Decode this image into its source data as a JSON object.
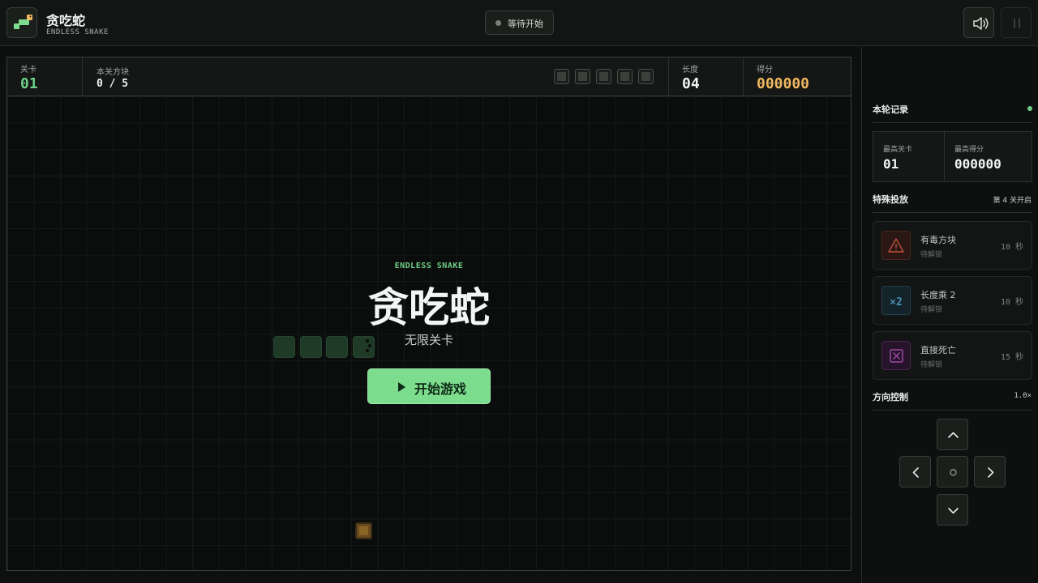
{
  "header": {
    "title": "贪吃蛇",
    "subtitle": "ENDLESS SNAKE",
    "status": "等待开始"
  },
  "stats": {
    "level_label": "关卡",
    "level_value": "01",
    "blocks_label": "本关方块",
    "blocks_value": "0 / 5",
    "length_label": "长度",
    "length_value": "04",
    "score_label": "得分",
    "score_value": "000000"
  },
  "overlay": {
    "kicker": "ENDLESS SNAKE",
    "title": "贪吃蛇",
    "subtitle": "无限关卡",
    "start_label": "开始游戏"
  },
  "records": {
    "section_title": "本轮记录",
    "best_level_label": "最高关卡",
    "best_level_value": "01",
    "best_score_label": "最高得分",
    "best_score_value": "000000"
  },
  "specials": {
    "section_title": "特殊投放",
    "unlock_note": "第 4 关开启",
    "items": [
      {
        "name": "有毒方块",
        "state": "待解锁",
        "duration": "10 秒",
        "icon": "warning-triangle-icon",
        "color": "#c0503f"
      },
      {
        "name": "长度乘 2",
        "state": "待解锁",
        "duration": "10 秒",
        "icon": "x2",
        "color": "#4a8fb0"
      },
      {
        "name": "直接死亡",
        "state": "待解锁",
        "duration": "15 秒",
        "icon": "x-box-icon",
        "color": "#a04aa8"
      }
    ]
  },
  "controls": {
    "section_title": "方向控制",
    "speed": "1.0×"
  },
  "colors": {
    "accent_green": "#7ddd8e",
    "score_gold": "#f0b860",
    "level_green": "#6fcf87"
  }
}
